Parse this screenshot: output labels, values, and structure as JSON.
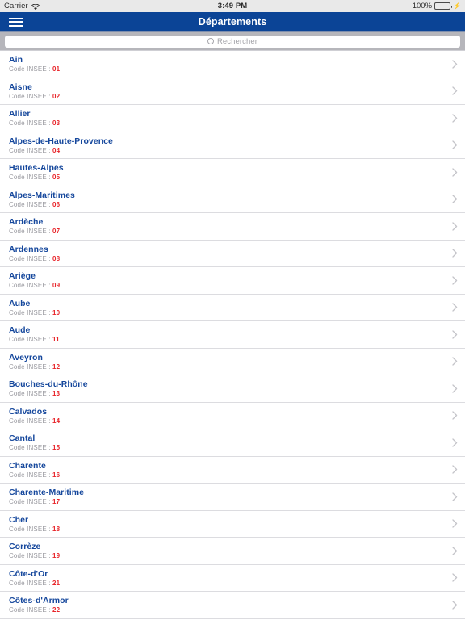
{
  "status_bar": {
    "carrier": "Carrier",
    "wifi_icon": "wifi-icon",
    "time": "3:49 PM",
    "battery_percent": "100%",
    "battery_icon": "battery-full-icon",
    "charging_icon": "lightning-bolt-icon"
  },
  "nav": {
    "menu_icon": "hamburger-menu-icon",
    "title": "Départements"
  },
  "search": {
    "icon": "search-icon",
    "placeholder": "Rechercher",
    "value": ""
  },
  "colors": {
    "nav_background": "#0b4496",
    "row_title": "#15479c",
    "code_value": "#e8252a",
    "sub_label": "#9a9aa0",
    "search_background": "#b6b6bb",
    "battery_green": "#2fbf3f",
    "separator": "#dcdce0"
  },
  "list": {
    "code_label": "Code INSEE :",
    "disclosure_icon": "chevron-right-icon",
    "items": [
      {
        "name": "Ain",
        "code": "01"
      },
      {
        "name": "Aisne",
        "code": "02"
      },
      {
        "name": "Allier",
        "code": "03"
      },
      {
        "name": "Alpes-de-Haute-Provence",
        "code": "04"
      },
      {
        "name": "Hautes-Alpes",
        "code": "05"
      },
      {
        "name": "Alpes-Maritimes",
        "code": "06"
      },
      {
        "name": "Ardèche",
        "code": "07"
      },
      {
        "name": "Ardennes",
        "code": "08"
      },
      {
        "name": "Ariège",
        "code": "09"
      },
      {
        "name": "Aube",
        "code": "10"
      },
      {
        "name": "Aude",
        "code": "11"
      },
      {
        "name": "Aveyron",
        "code": "12"
      },
      {
        "name": "Bouches-du-Rhône",
        "code": "13"
      },
      {
        "name": "Calvados",
        "code": "14"
      },
      {
        "name": "Cantal",
        "code": "15"
      },
      {
        "name": "Charente",
        "code": "16"
      },
      {
        "name": "Charente-Maritime",
        "code": "17"
      },
      {
        "name": "Cher",
        "code": "18"
      },
      {
        "name": "Corrèze",
        "code": "19"
      },
      {
        "name": "Côte-d'Or",
        "code": "21"
      },
      {
        "name": "Côtes-d'Armor",
        "code": "22"
      }
    ]
  }
}
